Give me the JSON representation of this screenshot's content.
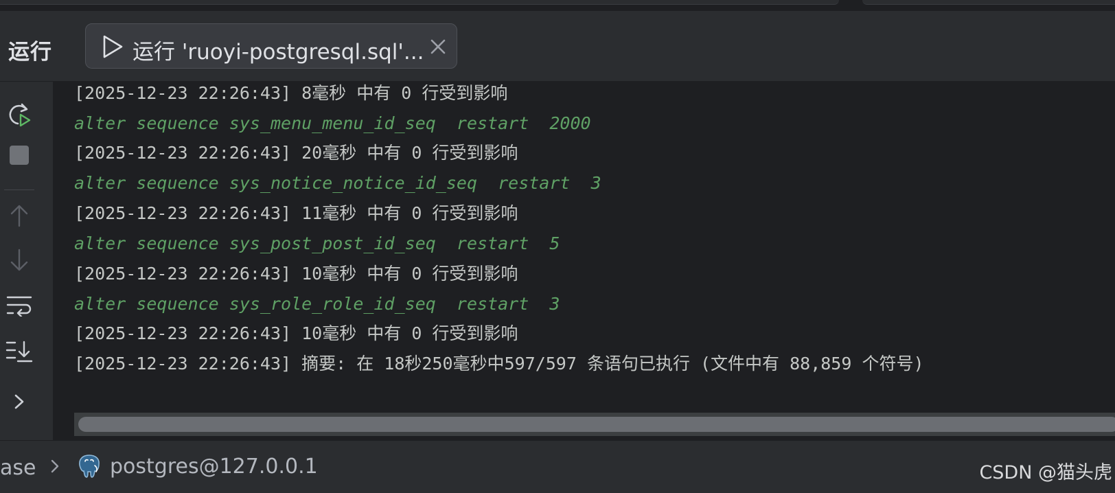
{
  "panel": {
    "title": "运行"
  },
  "run_tab": {
    "label": "运行 'ruoyi-postgresql.sql'...",
    "icon": "play-icon",
    "close_icon": "close-icon"
  },
  "toolbar": {
    "icons": [
      "rerun-icon",
      "stop-icon",
      "arrow-up-icon",
      "arrow-down-icon",
      "soft-wrap-icon",
      "scroll-to-end-icon",
      "chevron-right-icon"
    ]
  },
  "console": {
    "lines": [
      {
        "type": "log",
        "text": "[2025-12-23 22:26:43] 8毫秒 中有 0 行受到影响"
      },
      {
        "type": "sql",
        "text": "alter sequence sys_menu_menu_id_seq  restart  2000"
      },
      {
        "type": "log",
        "text": "[2025-12-23 22:26:43] 20毫秒 中有 0 行受到影响"
      },
      {
        "type": "sql",
        "text": "alter sequence sys_notice_notice_id_seq  restart  3"
      },
      {
        "type": "log",
        "text": "[2025-12-23 22:26:43] 11毫秒 中有 0 行受到影响"
      },
      {
        "type": "sql",
        "text": "alter sequence sys_post_post_id_seq  restart  5"
      },
      {
        "type": "log",
        "text": "[2025-12-23 22:26:43] 10毫秒 中有 0 行受到影响"
      },
      {
        "type": "sql",
        "text": "alter sequence sys_role_role_id_seq  restart  3"
      },
      {
        "type": "log",
        "text": "[2025-12-23 22:26:43] 10毫秒 中有 0 行受到影响"
      },
      {
        "type": "log",
        "text": "[2025-12-23 22:26:43] 摘要: 在 18秒250毫秒中597/597 条语句已执行 (文件中有 88,859 个符号)"
      }
    ]
  },
  "statusbar": {
    "crumb_prev": "ase",
    "connection": "postgres@127.0.0.1",
    "connection_icon": "postgresql-elephant-icon"
  },
  "watermark": "CSDN @猫头虎",
  "colors": {
    "sql_text": "#5fa165",
    "log_text": "#c5c8c6",
    "panel_bg": "#2b2d30",
    "console_bg": "#1e1f22"
  }
}
